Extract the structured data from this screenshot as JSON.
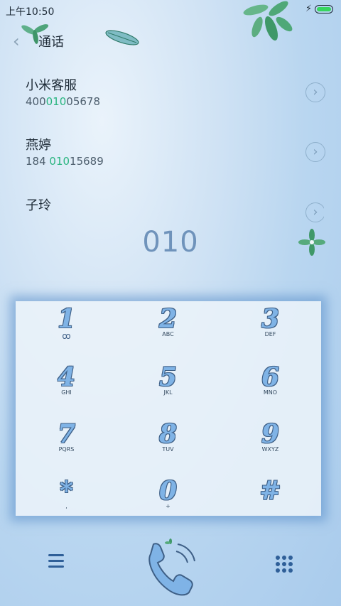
{
  "status_bar": {
    "time": "上午10:50"
  },
  "header": {
    "title": "通话"
  },
  "contacts": [
    {
      "name": "小米客服",
      "number_pre": "400",
      "number_match": "010",
      "number_post": "05678"
    },
    {
      "name": "燕婷",
      "number_pre": "184 ",
      "number_match": "010",
      "number_post": "15689"
    },
    {
      "name": "子玲"
    }
  ],
  "dialed_number": "010",
  "keypad": [
    {
      "digit": "1",
      "letters": "ꝏ"
    },
    {
      "digit": "2",
      "letters": "ABC"
    },
    {
      "digit": "3",
      "letters": "DEF"
    },
    {
      "digit": "4",
      "letters": "GHI"
    },
    {
      "digit": "5",
      "letters": "JKL"
    },
    {
      "digit": "6",
      "letters": "MNO"
    },
    {
      "digit": "7",
      "letters": "PQRS"
    },
    {
      "digit": "8",
      "letters": "TUV"
    },
    {
      "digit": "9",
      "letters": "WXYZ"
    },
    {
      "digit": "*",
      "letters": ","
    },
    {
      "digit": "0",
      "letters": "+"
    },
    {
      "digit": "#",
      "letters": ""
    }
  ],
  "colors": {
    "accent_match": "#2ab580",
    "digit_fill": "#7fb3e6",
    "battery": "#37d65f"
  }
}
